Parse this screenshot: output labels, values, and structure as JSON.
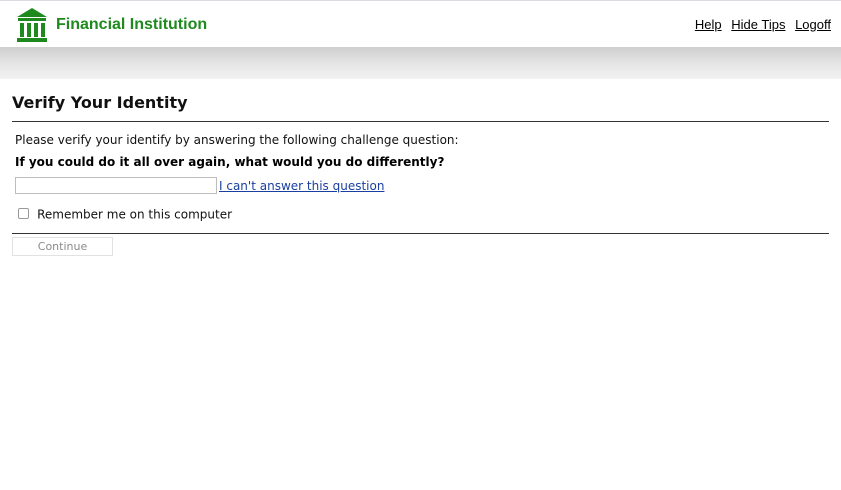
{
  "header": {
    "brand": "Financial Institution",
    "logo_icon": "bank-building-icon",
    "nav": {
      "help": "Help",
      "hide_tips": "Hide Tips",
      "logoff": "Logoff"
    }
  },
  "main": {
    "title": "Verify Your Identity",
    "instructions": "Please verify your identify by answering the following challenge question:",
    "question": "If you could do it all over again, what would you do differently?",
    "answer_value": "",
    "answer_placeholder": "",
    "cant_answer_link": "I can't answer this question",
    "remember_label": "Remember me on this computer",
    "remember_checked": false,
    "continue_label": "Continue"
  },
  "colors": {
    "brand_green": "#1e8a1e",
    "link_blue": "#1a3fa0",
    "rule": "#333333",
    "band_top": "#cfcfcf",
    "band_bottom": "#f2f2f2",
    "button_text_disabled": "#8a8a8a"
  }
}
